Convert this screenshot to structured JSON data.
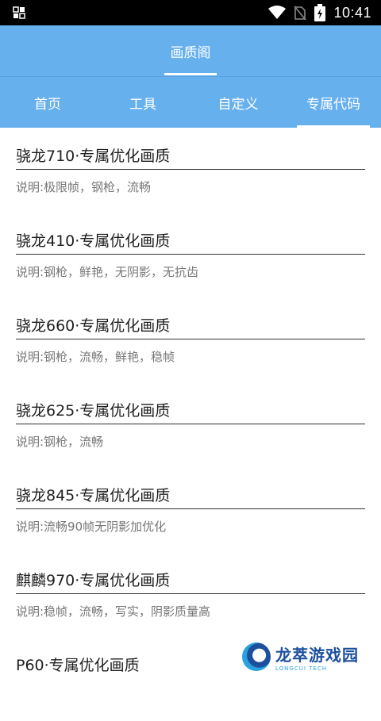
{
  "status_bar": {
    "time": "10:41",
    "icons": [
      "gallery-icon",
      "wifi-icon",
      "no-sim-icon",
      "battery-charging-icon"
    ]
  },
  "app_bar": {
    "title": "画质阁"
  },
  "tabs": [
    {
      "label": "首页",
      "active": false
    },
    {
      "label": "工具",
      "active": false
    },
    {
      "label": "自定义",
      "active": false
    },
    {
      "label": "专属代码",
      "active": true
    }
  ],
  "items": [
    {
      "name": "骁龙710·专属优化画质",
      "desc": "说明:极限帧，钢枪，流畅"
    },
    {
      "name": "骁龙410·专属优化画质",
      "desc": "说明:钢枪，鲜艳，无阴影，无抗齿"
    },
    {
      "name": "骁龙660·专属优化画质",
      "desc": "说明:钢枪，流畅，鲜艳，稳帧"
    },
    {
      "name": "骁龙625·专属优化画质",
      "desc": "说明:钢枪，流畅"
    },
    {
      "name": "骁龙845·专属优化画质",
      "desc": "说明:流畅90帧无阴影加优化"
    },
    {
      "name": "麒麟970·专属优化画质",
      "desc": "说明:稳帧，流畅，写实，阴影质量高"
    },
    {
      "name": "P60·专属优化画质",
      "desc": ""
    }
  ],
  "watermark": {
    "main": "龙萃游戏园",
    "sub": "LONGCUI TECH"
  },
  "colors": {
    "primary": "#67b0ee",
    "status_bar": "#000000"
  }
}
